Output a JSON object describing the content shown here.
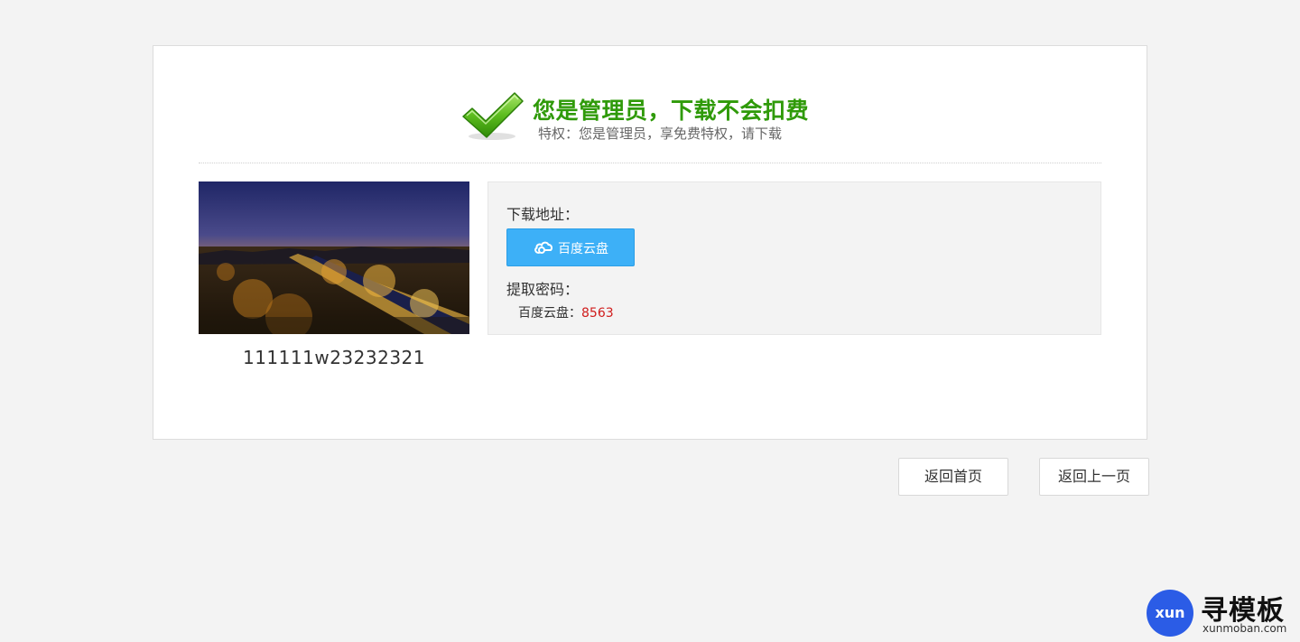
{
  "header": {
    "title": "您是管理员，下载不会扣费",
    "subtitle": "特权：您是管理员，享免费特权，请下载"
  },
  "item": {
    "title": "111111w23232321"
  },
  "download": {
    "address_label": "下载地址：",
    "button_label": "百度云盘",
    "password_label": "提取密码：",
    "code_prefix": "百度云盘：",
    "code_value": "8563"
  },
  "nav": {
    "home_label": "返回首页",
    "back_label": "返回上一页"
  },
  "brand": {
    "badge": "xun",
    "name": "寻模板",
    "url": "xunmoban.com"
  },
  "colors": {
    "success_green": "#2f9a09",
    "button_blue": "#3db0f7",
    "code_red": "#d01c1c",
    "brand_blue": "#2b5ce6"
  },
  "icons": {
    "success": "check-icon",
    "cloud": "cloud-icon"
  }
}
